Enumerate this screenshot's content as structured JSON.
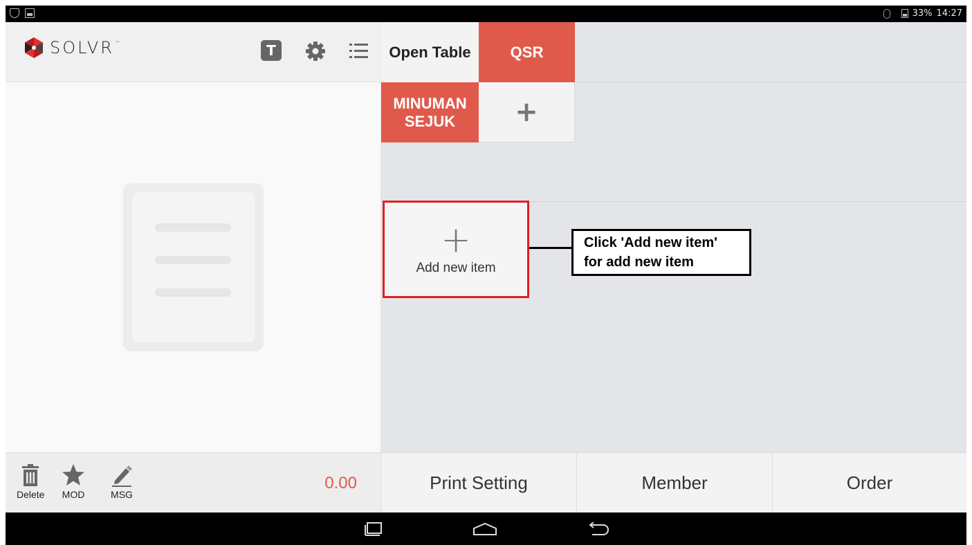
{
  "status_bar": {
    "battery": "33%",
    "time": "14:27"
  },
  "header": {
    "logo_text": "SOLVR",
    "logo_tm": "™",
    "t_icon_label": "T",
    "tabs": [
      {
        "label": "Open Table"
      },
      {
        "label": "QSR"
      }
    ]
  },
  "categories": {
    "items": [
      {
        "label": "MINUMAN SEJUK"
      }
    ],
    "add_symbol": "+"
  },
  "items": {
    "add_new": {
      "symbol": "+",
      "label": "Add new item"
    }
  },
  "callout": {
    "line1": "Click 'Add new item'",
    "line2": "for add new item"
  },
  "toolbar": {
    "delete_label": "Delete",
    "mod_label": "MOD",
    "msg_label": "MSG",
    "total": "0.00"
  },
  "actions": {
    "print_setting": "Print Setting",
    "member": "Member",
    "order": "Order"
  },
  "colors": {
    "accent": "#e05a4b",
    "highlight_border": "#e01e24"
  }
}
